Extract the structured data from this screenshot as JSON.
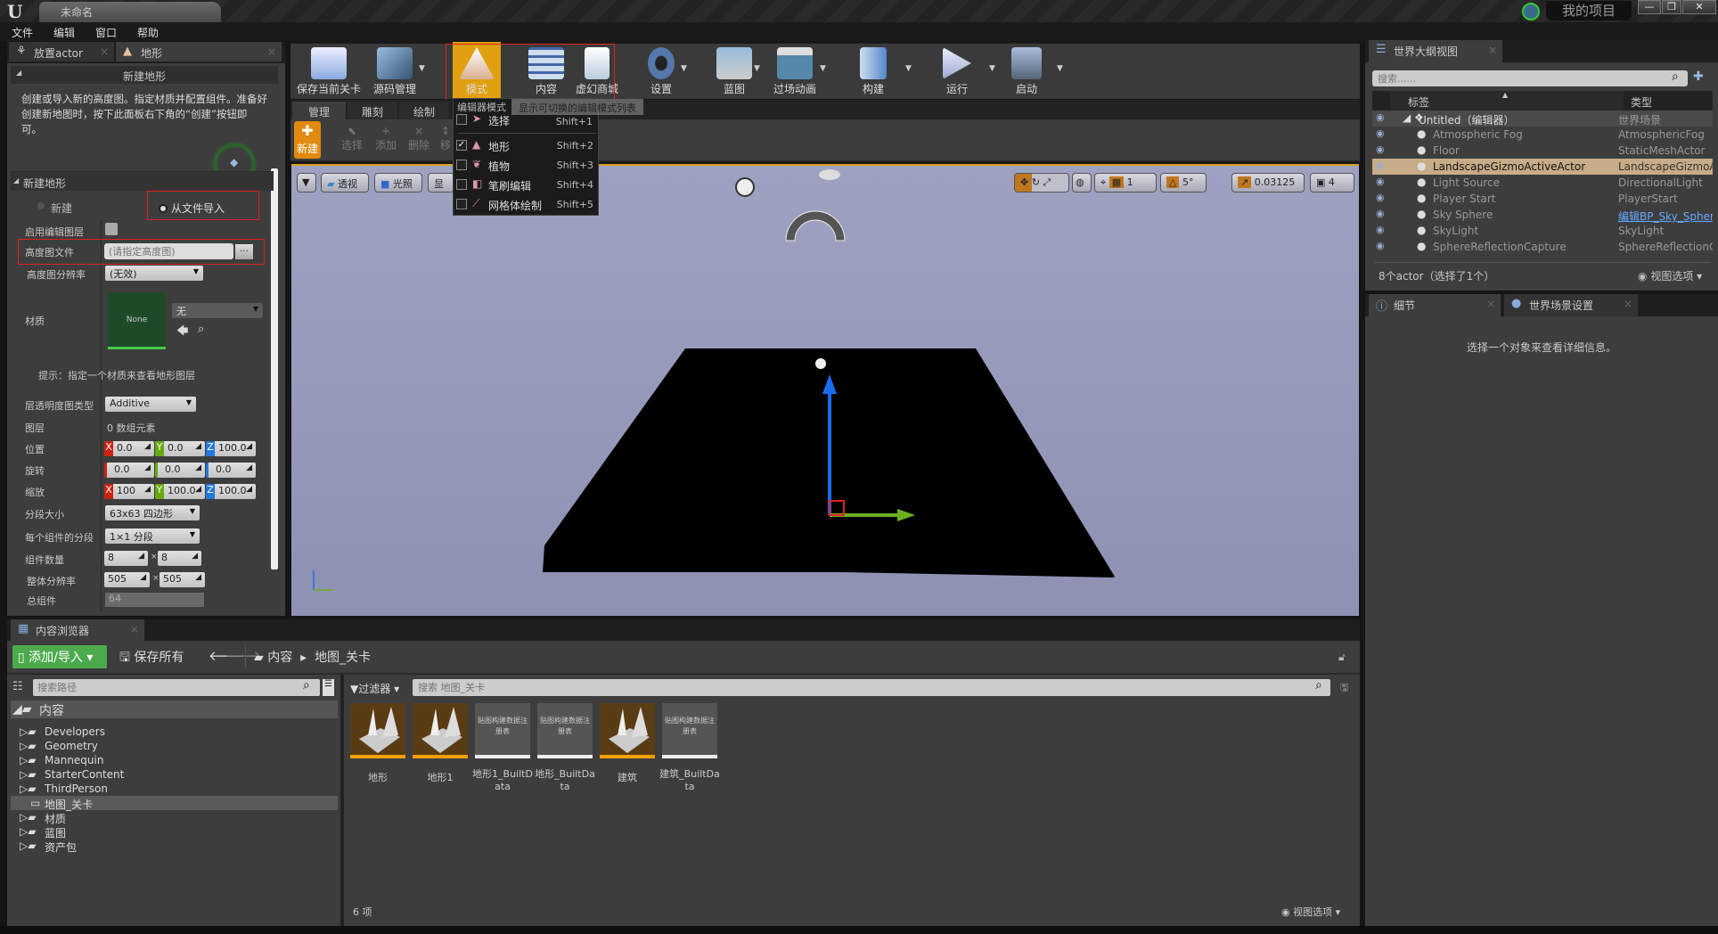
{
  "window": {
    "title": "未命名",
    "project": "我的项目",
    "minimize": "—",
    "restore": "❐",
    "close": "✕"
  },
  "menu": [
    "文件",
    "编辑",
    "窗口",
    "帮助"
  ],
  "left_panel": {
    "tabs": [
      {
        "label": "放置actor",
        "icon": "place-actor-icon"
      },
      {
        "label": "地形",
        "icon": "landscape-icon"
      }
    ],
    "section_title": "新建地形",
    "description": "创建或导入新的高度图。指定材质并配置组件。准备好创建新地图时，按下此面板右下角的“创建”按钮即可。",
    "subsection": "新建地形",
    "radio_new": "新建",
    "radio_import": "从文件导入",
    "selected_mode": "从文件导入",
    "fields": {
      "enable_edit_layers": {
        "label": "启用编辑图层",
        "checked": false
      },
      "heightmap_file": {
        "label": "高度图文件",
        "placeholder": "(请指定高度图)",
        "browse": "..."
      },
      "heightmap_resolution": {
        "label": "高度图分辨率",
        "value": "(无效)"
      },
      "material": {
        "label": "材质",
        "thumb": "None",
        "value": "无"
      },
      "hint": "提示：指定一个材质来查看地形图层",
      "layer_alpha_type": {
        "label": "层透明度图类型",
        "value": "Additive"
      },
      "layers": {
        "label": "图层",
        "value": "0 数组元素"
      },
      "location": {
        "label": "位置",
        "x": "0.0",
        "y": "0.0",
        "z": "100.0"
      },
      "rotation": {
        "label": "旋转",
        "x": "0.0",
        "y": "0.0",
        "z": "0.0"
      },
      "scale": {
        "label": "缩放",
        "x": "100",
        "y": "100.0",
        "z": "100.0"
      },
      "section_size": {
        "label": "分段大小",
        "value": "63x63 四边形"
      },
      "sections_per_component": {
        "label": "每个组件的分段",
        "value": "1×1 分段"
      },
      "component_count": {
        "label": "组件数量",
        "x": "8",
        "y": "8"
      },
      "overall_resolution": {
        "label": "整体分辨率",
        "x": "505",
        "y": "505"
      },
      "total_components": {
        "label": "总组件",
        "value": "64"
      }
    }
  },
  "toolbar": {
    "buttons": [
      {
        "label": "保存当前关卡",
        "icon": "save-icon"
      },
      {
        "label": "源码管理",
        "icon": "source-control-icon"
      },
      {
        "label": "模式",
        "icon": "modes-icon"
      },
      {
        "label": "内容",
        "icon": "content-icon"
      },
      {
        "label": "虚幻商城",
        "icon": "marketplace-icon"
      },
      {
        "label": "设置",
        "icon": "settings-icon"
      },
      {
        "label": "蓝图",
        "icon": "blueprint-icon"
      },
      {
        "label": "过场动画",
        "icon": "cinematics-icon"
      },
      {
        "label": "构建",
        "icon": "build-icon"
      },
      {
        "label": "运行",
        "icon": "play-icon"
      },
      {
        "label": "启动",
        "icon": "launch-icon"
      }
    ],
    "mode_tabs": [
      "管理",
      "雕刻",
      "绘制"
    ],
    "tools": [
      "新建",
      "选择",
      "添加",
      "删除",
      "移"
    ],
    "tooltip": "显示可切换的编辑模式列表"
  },
  "modes_menu": {
    "header": "编辑器模式",
    "items": [
      {
        "label": "选择",
        "shortcut": "Shift+1",
        "checked": false
      },
      {
        "label": "地形",
        "shortcut": "Shift+2",
        "checked": true
      },
      {
        "label": "植物",
        "shortcut": "Shift+3",
        "checked": false
      },
      {
        "label": "笔刷编辑",
        "shortcut": "Shift+4",
        "checked": false
      },
      {
        "label": "网格体绘制",
        "shortcut": "Shift+5",
        "checked": false
      }
    ]
  },
  "viewport": {
    "perspective": "透视",
    "lighting": "光照",
    "show": "显示",
    "grid_snap": "1",
    "rot_snap": "5°",
    "scale_snap": "0.03125",
    "camera_speed": "4",
    "bg": "#9a9cbc"
  },
  "outliner": {
    "tab": "世界大纲视图",
    "search_placeholder": "搜索......",
    "col_label": "标签",
    "col_type": "类型",
    "rows": [
      {
        "name": "Untitled（编辑器）",
        "type": "世界场景"
      },
      {
        "name": "Atmospheric Fog",
        "type": "AtmosphericFog"
      },
      {
        "name": "Floor",
        "type": "StaticMeshActor"
      },
      {
        "name": "LandscapeGizmoActiveActor",
        "type": "LandscapeGizmoActiveActor",
        "selected": true
      },
      {
        "name": "Light Source",
        "type": "DirectionalLight"
      },
      {
        "name": "Player Start",
        "type": "PlayerStart"
      },
      {
        "name": "Sky Sphere",
        "type": "编辑BP_Sky_Sphere",
        "link": true
      },
      {
        "name": "SkyLight",
        "type": "SkyLight"
      },
      {
        "name": "SphereReflectionCapture",
        "type": "SphereReflectionCapture"
      }
    ],
    "footer": "8个actor（选择了1个）",
    "view_options": "视图选项"
  },
  "details": {
    "tabs": [
      "细节",
      "世界场景设置"
    ],
    "empty": "选择一个对象来查看详细信息。"
  },
  "content_browser": {
    "tab": "内容浏览器",
    "add_import": "添加/导入",
    "save_all": "保存所有",
    "breadcrumb": [
      "内容",
      "地图_关卡"
    ],
    "path_search_placeholder": "搜索路径",
    "filter": "过滤器",
    "search_placeholder": "搜索 地图_关卡",
    "tree": [
      {
        "label": "内容",
        "root": true
      },
      {
        "label": "Developers"
      },
      {
        "label": "Geometry"
      },
      {
        "label": "Mannequin"
      },
      {
        "label": "StarterContent"
      },
      {
        "label": "ThirdPerson"
      },
      {
        "label": "地图_关卡",
        "selected": true
      },
      {
        "label": "材质"
      },
      {
        "label": "蓝图"
      },
      {
        "label": "资产包"
      }
    ],
    "assets": [
      {
        "name": "地形",
        "kind": "map"
      },
      {
        "name": "地形1",
        "kind": "map"
      },
      {
        "name": "地形1_BuiltData",
        "kind": "registry",
        "thumb_text": "贴图构建数据注册表"
      },
      {
        "name": "地形_BuiltData",
        "kind": "registry",
        "thumb_text": "贴图构建数据注册表"
      },
      {
        "name": "建筑",
        "kind": "map"
      },
      {
        "name": "建筑_BuiltData",
        "kind": "registry",
        "thumb_text": "贴图构建数据注册表"
      }
    ],
    "count": "6 项",
    "view_options": "视图选项"
  }
}
